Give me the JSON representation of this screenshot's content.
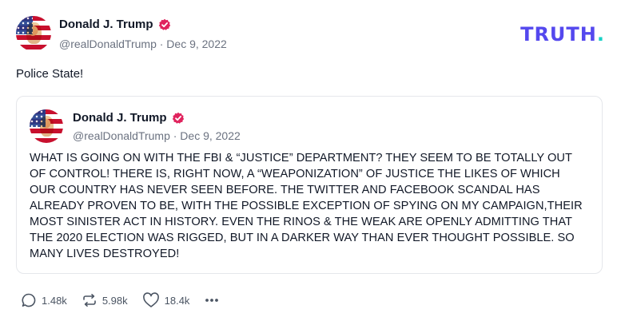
{
  "post": {
    "author_name": "Donald J. Trump",
    "handle_date": "@realDonaldTrump · Dec 9, 2022",
    "text": "Police State!"
  },
  "brand": {
    "logo_text": "TRUTH",
    "logo_dot": ".",
    "logo_color": "#5448ee",
    "dot_color": "#17d1c6"
  },
  "quoted": {
    "author_name": "Donald J. Trump",
    "handle_date": "@realDonaldTrump · Dec 9, 2022",
    "text": "WHAT IS GOING ON WITH THE FBI & “JUSTICE” DEPARTMENT? THEY SEEM TO BE TOTALLY OUT OF CONTROL! THERE IS, RIGHT NOW, A “WEAPONIZATION” OF JUSTICE THE LIKES OF WHICH OUR COUNTRY HAS NEVER SEEN BEFORE. THE TWITTER AND FACEBOOK SCANDAL HAS ALREADY PROVEN TO BE, WITH THE POSSIBLE EXCEPTION OF SPYING ON MY CAMPAIGN,THEIR MOST SINISTER ACT IN HISTORY. EVEN THE RINOS & THE WEAK ARE OPENLY ADMITTING THAT THE 2020 ELECTION WAS RIGGED, BUT IN A DARKER WAY THAN EVER THOUGHT POSSIBLE. SO MANY LIVES DESTROYED!"
  },
  "actions": {
    "replies": "1.48k",
    "retruths": "5.98k",
    "likes": "18.4k"
  },
  "icons": {
    "verified": "verified-badge-icon",
    "reply": "reply-bubble-icon",
    "retruth": "retruth-arrows-icon",
    "like": "heart-icon",
    "more": "more-dots-icon"
  },
  "colors": {
    "verified": "#e0245e"
  }
}
